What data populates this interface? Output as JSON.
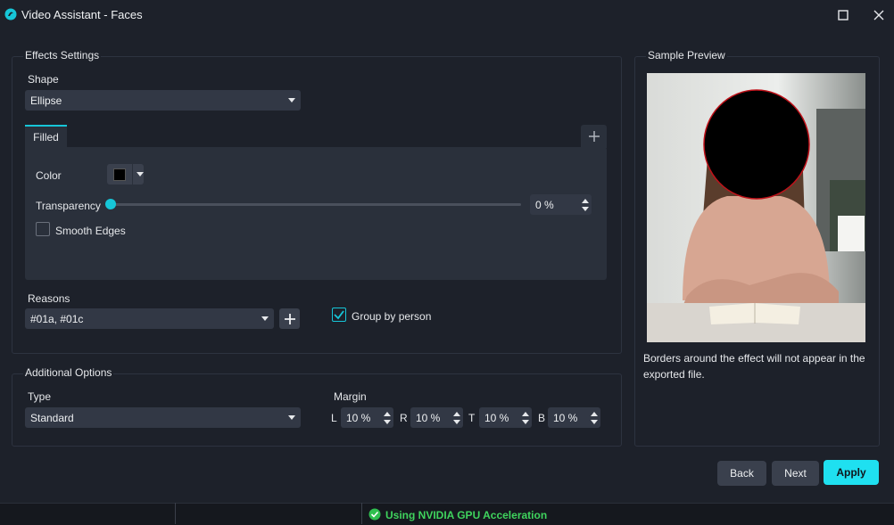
{
  "window": {
    "title": "Video Assistant - Faces"
  },
  "effects": {
    "group_title": "Effects Settings",
    "shape_label": "Shape",
    "shape_value": "Ellipse",
    "tab_label": "Filled",
    "color_label": "Color",
    "color_value": "#000000",
    "transparency_label": "Transparency",
    "transparency_value": "0 %",
    "transparency_fraction": 0,
    "smooth_edges_label": "Smooth Edges",
    "smooth_edges_checked": false,
    "reasons_label": "Reasons",
    "reasons_value": "#01a, #01c",
    "group_by_person_label": "Group by person",
    "group_by_person_checked": true
  },
  "additional": {
    "group_title": "Additional Options",
    "type_label": "Type",
    "type_value": "Standard",
    "margin_label": "Margin",
    "margins": [
      {
        "letter": "L",
        "value": "10 %"
      },
      {
        "letter": "R",
        "value": "10 %"
      },
      {
        "letter": "T",
        "value": "10 %"
      },
      {
        "letter": "B",
        "value": "10 %"
      }
    ]
  },
  "preview": {
    "group_title": "Sample Preview",
    "note": "Borders around the effect will not appear in the exported file."
  },
  "buttons": {
    "back": "Back",
    "next": "Next",
    "apply": "Apply"
  },
  "status": {
    "gpu": "Using NVIDIA GPU Acceleration"
  },
  "colors": {
    "accent": "#16c6d8",
    "apply": "#1fe0f0",
    "status_ok": "#2fbf4f"
  }
}
